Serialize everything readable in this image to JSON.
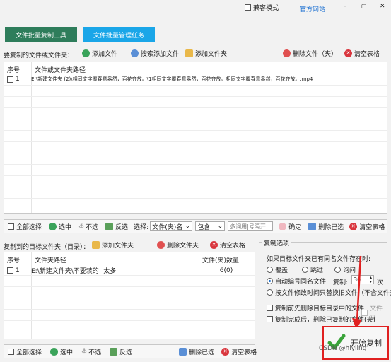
{
  "titlebar": {
    "compat_label": "兼容模式",
    "website_label": "官方网站",
    "minimize": "–",
    "maximize": "▢",
    "close": "✕"
  },
  "tabs": [
    {
      "label": "文件批量复制工具",
      "bg": "#2e7d5b"
    },
    {
      "label": "文件批量管理任务",
      "bg": "#1aa6e8"
    }
  ],
  "source": {
    "section_label": "要复制的文件或文件夹：",
    "add_file": "添加文件",
    "search_add_file": "搜索添加文件",
    "add_folder": "添加文件夹",
    "delete_file": "删除文件（夹）",
    "clear_table": "清空表格",
    "col_index": "序号",
    "col_path": "文件或文件夹路径",
    "rows": [
      {
        "index": "1",
        "path": "E:\\新建文件夹 (2)\\相同文字覆春意盎然，百花齐放。\\1相同文字覆春意盎然，百花齐放。相同文字覆春意盎然，百花齐放。.mp4"
      }
    ]
  },
  "filterbar": {
    "select_all": "全部选择",
    "select": "选中",
    "unselect": "不选",
    "invert": "反选",
    "choose_label": "选择:",
    "field_value": "文件(夹)名",
    "op_value": "包含",
    "keyword_placeholder": "多词用|号隔开",
    "confirm": "确定",
    "delete_selected": "删除已选",
    "clear_table": "清空表格"
  },
  "target": {
    "section_label": "复制到的目标文件夹（目录）：",
    "add_folder": "添加文件夹",
    "delete_folder": "删除文件夹",
    "clear_table": "清空表格",
    "col_index": "序号",
    "col_path": "文件夹路径",
    "col_count": "文件(夹)数量",
    "rows": [
      {
        "index": "1",
        "path": "E:\\新建文件夹\\不要装的! 太多",
        "count": "6(0)"
      }
    ]
  },
  "bottombar": {
    "select_all": "全部选择",
    "select": "选中",
    "unselect": "不选",
    "invert": "反选",
    "delete_selected": "删除已选",
    "clear_table": "清空表格"
  },
  "options": {
    "title": "复制选项",
    "exists_label": "如果目标文件夹已有同名文件存在时:",
    "overwrite": "覆盖",
    "skip": "跳过",
    "ask": "询问",
    "auto_rename": "自动编号同名文件",
    "copy_label": "复制:",
    "copy_value": "30",
    "times_label": "次",
    "by_modified": "按文件修改时间只替换旧文件（不含文件夹）",
    "clear_before": "复制前先删除目标目录中的文件",
    "files_folder": "文件夹",
    "delete_after": "复制完成后，删除已复制的文件(夹)"
  },
  "start_button": {
    "label": "开始复制"
  },
  "watermark": "CSDN @hlyling"
}
